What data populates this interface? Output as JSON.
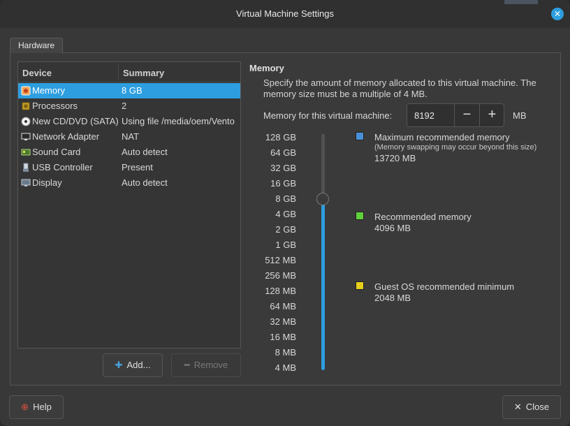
{
  "window": {
    "title": "Virtual Machine Settings"
  },
  "tabs": [
    {
      "label": "Hardware"
    }
  ],
  "device_list": {
    "columns": {
      "device": "Device",
      "summary": "Summary"
    },
    "rows": [
      {
        "name": "Memory",
        "summary": "8 GB",
        "icon": "memory-icon",
        "selected": true
      },
      {
        "name": "Processors",
        "summary": "2",
        "icon": "processor-icon"
      },
      {
        "name": "New CD/DVD (SATA)",
        "summary": "Using file /media/oem/Vento",
        "icon": "cd-dvd-icon"
      },
      {
        "name": "Network Adapter",
        "summary": "NAT",
        "icon": "network-adapter-icon"
      },
      {
        "name": "Sound Card",
        "summary": "Auto detect",
        "icon": "sound-card-icon"
      },
      {
        "name": "USB Controller",
        "summary": "Present",
        "icon": "usb-icon"
      },
      {
        "name": "Display",
        "summary": "Auto detect",
        "icon": "display-icon"
      }
    ]
  },
  "buttons": {
    "add": "Add...",
    "remove": "Remove",
    "help": "Help",
    "close": "Close"
  },
  "memory": {
    "heading": "Memory",
    "description": "Specify the amount of memory allocated to this virtual machine. The memory size must be a multiple of 4 MB.",
    "field_label": "Memory for this virtual machine:",
    "value": "8192",
    "unit": "MB",
    "scale": [
      "128 GB",
      "64 GB",
      "32 GB",
      "16 GB",
      "8 GB",
      "4 GB",
      "2 GB",
      "1 GB",
      "512 MB",
      "256 MB",
      "128 MB",
      "64 MB",
      "32 MB",
      "16 MB",
      "8 MB",
      "4 MB"
    ],
    "slider_selected": "8 GB",
    "legend": {
      "max": {
        "label": "Maximum recommended memory",
        "note": "(Memory swapping may occur beyond this size)",
        "value": "13720 MB",
        "color": "#4a90d9"
      },
      "recommended": {
        "label": "Recommended memory",
        "value": "4096 MB",
        "color": "#5fd03a"
      },
      "minimum": {
        "label": "Guest OS recommended minimum",
        "value": "2048 MB",
        "color": "#e6cf1c"
      }
    }
  },
  "colors": {
    "accent": "#2d9ee0"
  }
}
